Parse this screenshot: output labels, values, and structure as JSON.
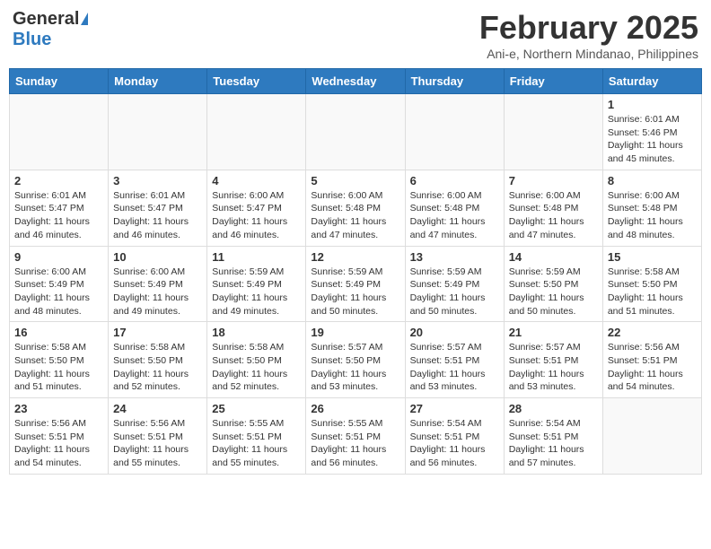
{
  "logo": {
    "general": "General",
    "blue": "Blue"
  },
  "header": {
    "month": "February 2025",
    "location": "Ani-e, Northern Mindanao, Philippines"
  },
  "weekdays": [
    "Sunday",
    "Monday",
    "Tuesday",
    "Wednesday",
    "Thursday",
    "Friday",
    "Saturday"
  ],
  "weeks": [
    [
      {
        "day": "",
        "info": ""
      },
      {
        "day": "",
        "info": ""
      },
      {
        "day": "",
        "info": ""
      },
      {
        "day": "",
        "info": ""
      },
      {
        "day": "",
        "info": ""
      },
      {
        "day": "",
        "info": ""
      },
      {
        "day": "1",
        "info": "Sunrise: 6:01 AM\nSunset: 5:46 PM\nDaylight: 11 hours\nand 45 minutes."
      }
    ],
    [
      {
        "day": "2",
        "info": "Sunrise: 6:01 AM\nSunset: 5:47 PM\nDaylight: 11 hours\nand 46 minutes."
      },
      {
        "day": "3",
        "info": "Sunrise: 6:01 AM\nSunset: 5:47 PM\nDaylight: 11 hours\nand 46 minutes."
      },
      {
        "day": "4",
        "info": "Sunrise: 6:00 AM\nSunset: 5:47 PM\nDaylight: 11 hours\nand 46 minutes."
      },
      {
        "day": "5",
        "info": "Sunrise: 6:00 AM\nSunset: 5:48 PM\nDaylight: 11 hours\nand 47 minutes."
      },
      {
        "day": "6",
        "info": "Sunrise: 6:00 AM\nSunset: 5:48 PM\nDaylight: 11 hours\nand 47 minutes."
      },
      {
        "day": "7",
        "info": "Sunrise: 6:00 AM\nSunset: 5:48 PM\nDaylight: 11 hours\nand 47 minutes."
      },
      {
        "day": "8",
        "info": "Sunrise: 6:00 AM\nSunset: 5:48 PM\nDaylight: 11 hours\nand 48 minutes."
      }
    ],
    [
      {
        "day": "9",
        "info": "Sunrise: 6:00 AM\nSunset: 5:49 PM\nDaylight: 11 hours\nand 48 minutes."
      },
      {
        "day": "10",
        "info": "Sunrise: 6:00 AM\nSunset: 5:49 PM\nDaylight: 11 hours\nand 49 minutes."
      },
      {
        "day": "11",
        "info": "Sunrise: 5:59 AM\nSunset: 5:49 PM\nDaylight: 11 hours\nand 49 minutes."
      },
      {
        "day": "12",
        "info": "Sunrise: 5:59 AM\nSunset: 5:49 PM\nDaylight: 11 hours\nand 50 minutes."
      },
      {
        "day": "13",
        "info": "Sunrise: 5:59 AM\nSunset: 5:49 PM\nDaylight: 11 hours\nand 50 minutes."
      },
      {
        "day": "14",
        "info": "Sunrise: 5:59 AM\nSunset: 5:50 PM\nDaylight: 11 hours\nand 50 minutes."
      },
      {
        "day": "15",
        "info": "Sunrise: 5:58 AM\nSunset: 5:50 PM\nDaylight: 11 hours\nand 51 minutes."
      }
    ],
    [
      {
        "day": "16",
        "info": "Sunrise: 5:58 AM\nSunset: 5:50 PM\nDaylight: 11 hours\nand 51 minutes."
      },
      {
        "day": "17",
        "info": "Sunrise: 5:58 AM\nSunset: 5:50 PM\nDaylight: 11 hours\nand 52 minutes."
      },
      {
        "day": "18",
        "info": "Sunrise: 5:58 AM\nSunset: 5:50 PM\nDaylight: 11 hours\nand 52 minutes."
      },
      {
        "day": "19",
        "info": "Sunrise: 5:57 AM\nSunset: 5:50 PM\nDaylight: 11 hours\nand 53 minutes."
      },
      {
        "day": "20",
        "info": "Sunrise: 5:57 AM\nSunset: 5:51 PM\nDaylight: 11 hours\nand 53 minutes."
      },
      {
        "day": "21",
        "info": "Sunrise: 5:57 AM\nSunset: 5:51 PM\nDaylight: 11 hours\nand 53 minutes."
      },
      {
        "day": "22",
        "info": "Sunrise: 5:56 AM\nSunset: 5:51 PM\nDaylight: 11 hours\nand 54 minutes."
      }
    ],
    [
      {
        "day": "23",
        "info": "Sunrise: 5:56 AM\nSunset: 5:51 PM\nDaylight: 11 hours\nand 54 minutes."
      },
      {
        "day": "24",
        "info": "Sunrise: 5:56 AM\nSunset: 5:51 PM\nDaylight: 11 hours\nand 55 minutes."
      },
      {
        "day": "25",
        "info": "Sunrise: 5:55 AM\nSunset: 5:51 PM\nDaylight: 11 hours\nand 55 minutes."
      },
      {
        "day": "26",
        "info": "Sunrise: 5:55 AM\nSunset: 5:51 PM\nDaylight: 11 hours\nand 56 minutes."
      },
      {
        "day": "27",
        "info": "Sunrise: 5:54 AM\nSunset: 5:51 PM\nDaylight: 11 hours\nand 56 minutes."
      },
      {
        "day": "28",
        "info": "Sunrise: 5:54 AM\nSunset: 5:51 PM\nDaylight: 11 hours\nand 57 minutes."
      },
      {
        "day": "",
        "info": ""
      }
    ]
  ]
}
